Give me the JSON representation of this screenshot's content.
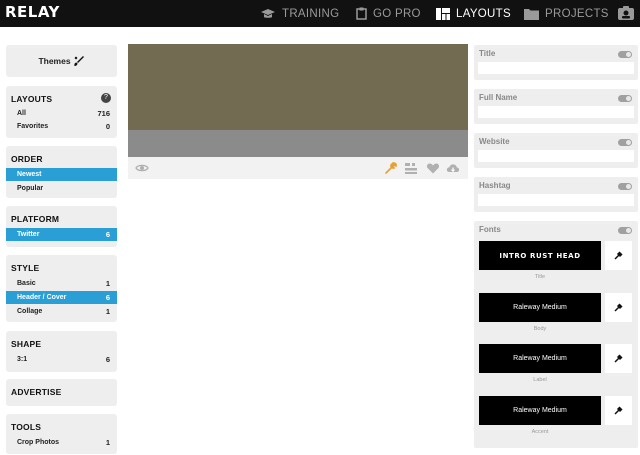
{
  "topbar": {
    "logo": "RELAY",
    "nav": [
      {
        "label": "TRAINING",
        "icon": "graduation-cap-icon"
      },
      {
        "label": "GO PRO",
        "icon": "clipboard-icon"
      },
      {
        "label": "LAYOUTS",
        "icon": "layouts-grid-icon"
      },
      {
        "label": "PROJECTS",
        "icon": "folder-icon"
      }
    ],
    "user_icon": "user-card-icon"
  },
  "sidebar": {
    "themes_label": "Themes",
    "layouts": {
      "title": "LAYOUTS",
      "help": "?",
      "items": [
        {
          "label": "All",
          "count": "716"
        },
        {
          "label": "Favorites",
          "count": "0"
        }
      ]
    },
    "order": {
      "title": "ORDER",
      "items": [
        {
          "label": "Newest",
          "selected": true
        },
        {
          "label": "Popular",
          "selected": false
        }
      ]
    },
    "platform": {
      "title": "PLATFORM",
      "items": [
        {
          "label": "Twitter",
          "count": "6",
          "selected": true
        }
      ]
    },
    "style": {
      "title": "STYLE",
      "items": [
        {
          "label": "Basic",
          "count": "1"
        },
        {
          "label": "Header / Cover",
          "count": "6",
          "selected": true
        },
        {
          "label": "Collage",
          "count": "1"
        }
      ]
    },
    "shape": {
      "title": "SHAPE",
      "items": [
        {
          "label": "3:1",
          "count": "6"
        }
      ]
    },
    "advertise": {
      "title": "ADVERTISE"
    },
    "tools": {
      "title": "TOOLS",
      "items": [
        {
          "label": "Crop Photos",
          "count": "1"
        }
      ]
    }
  },
  "preview": {
    "colors": {
      "image": "#736a52",
      "bottom": "#8b8b8b",
      "accent": "#e8a030"
    },
    "toolbar_icons": [
      "eye-icon",
      "wrench-icon",
      "sliders-icon",
      "heart-icon",
      "cloud-download-icon"
    ]
  },
  "fields": [
    {
      "label": "Title",
      "value": ""
    },
    {
      "label": "Full Name",
      "value": ""
    },
    {
      "label": "Website",
      "value": ""
    },
    {
      "label": "Hashtag",
      "value": ""
    }
  ],
  "fonts": {
    "title": "Fonts",
    "items": [
      {
        "name": "INTRO RUST HEAD",
        "caption": "Title"
      },
      {
        "name": "Raleway Medium",
        "caption": "Body"
      },
      {
        "name": "Raleway Medium",
        "caption": "Label"
      },
      {
        "name": "Raleway Medium",
        "caption": "Accent"
      }
    ]
  }
}
